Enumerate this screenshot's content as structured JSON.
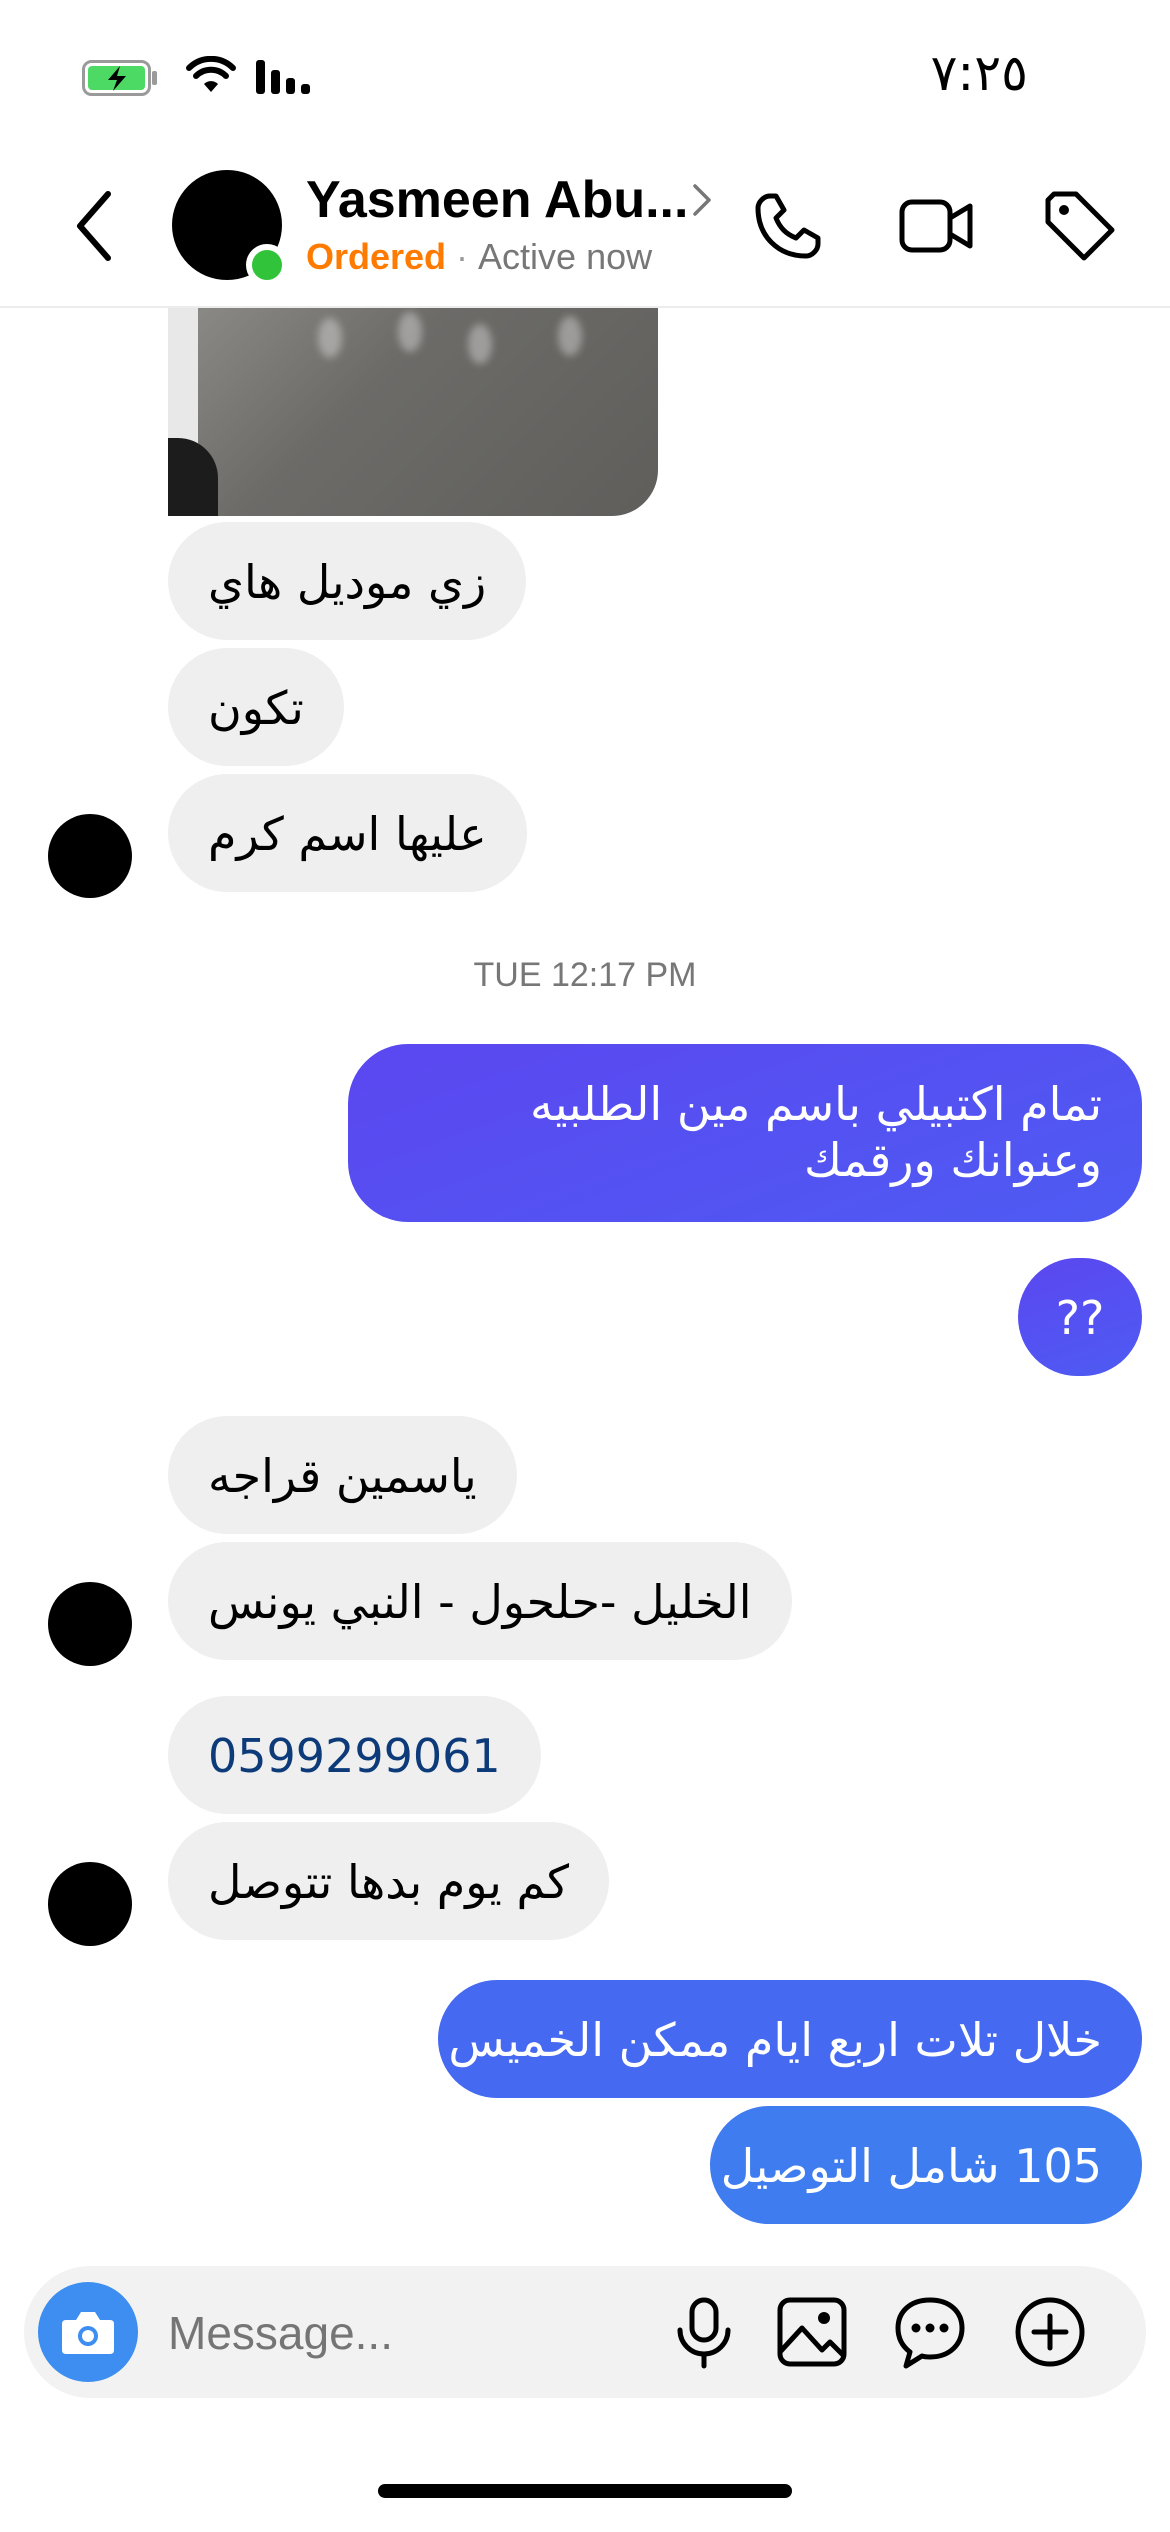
{
  "status_bar": {
    "time": "٧:٢٥",
    "battery_state": "charging",
    "accent_battery": "#4cd964"
  },
  "header": {
    "contact_name": "Yasmeen Abu...",
    "status_label": "Ordered",
    "separator": "·",
    "activity": "Active now",
    "icons": [
      "back-icon",
      "phone-icon",
      "video-icon",
      "tag-icon"
    ],
    "colors": {
      "ordered": "#ff7a00",
      "online": "#31c43a"
    }
  },
  "messages": {
    "m1": "زي موديل هاي",
    "m2": "تكون",
    "m3": "عليها اسم كرم",
    "timestamp": "TUE 12:17 PM",
    "m4": "تمام اكتبيلي باسم مين الطلبيه وعنوانك ورقمك",
    "m5": "??",
    "m6": "ياسمين قراجه",
    "m7": "الخليل -حلحول  - النبي يونس",
    "m8": "0599299061",
    "m9": "كم يوم بدها تتوصل",
    "m10": "خلال تلات اربع ايام ممكن الخميس",
    "m11": "105 شامل التوصيل"
  },
  "composer": {
    "placeholder": "Message...",
    "icons": [
      "camera-icon",
      "microphone-icon",
      "gallery-icon",
      "sticker-icon",
      "plus-icon"
    ],
    "accent": "#3d8ef0"
  }
}
